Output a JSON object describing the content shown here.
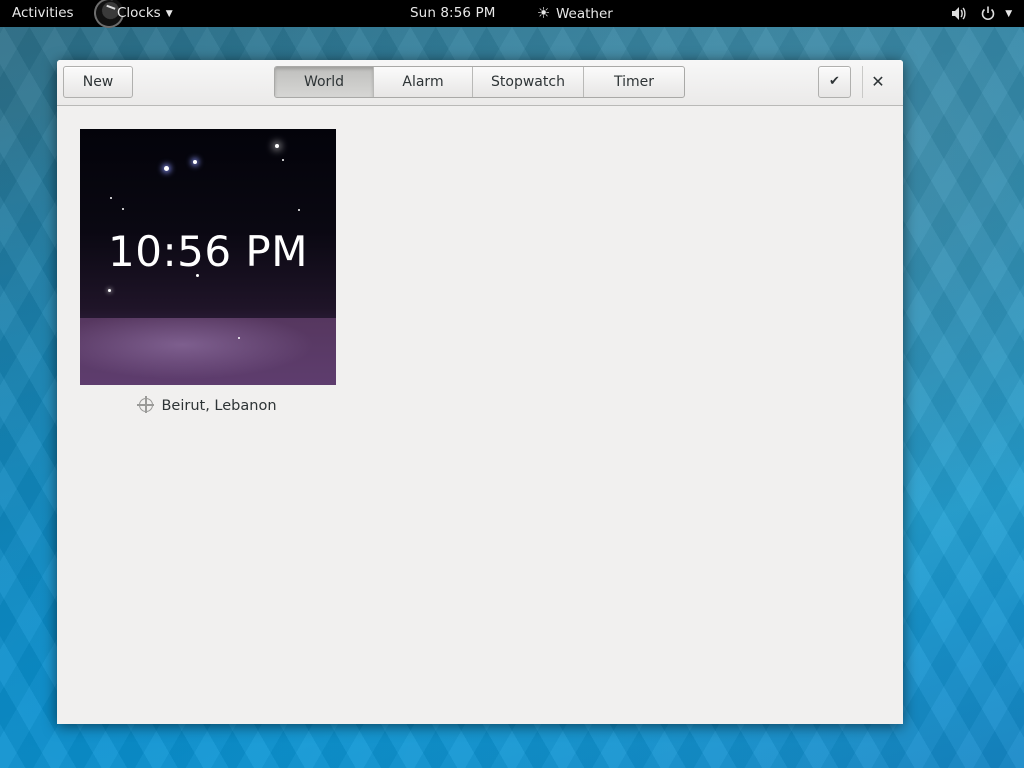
{
  "topbar": {
    "activities": "Activities",
    "app_menu": "Clocks",
    "clock": "Sun  8:56 PM",
    "weather": "Weather",
    "icons": {
      "app": "clocks-app-icon",
      "weather": "sun-icon",
      "volume": "volume-icon",
      "power": "power-icon"
    }
  },
  "headerbar": {
    "new_label": "New",
    "tabs": [
      {
        "label": "World",
        "active": true
      },
      {
        "label": "Alarm",
        "active": false
      },
      {
        "label": "Stopwatch",
        "active": false
      },
      {
        "label": "Timer",
        "active": false
      }
    ],
    "select_icon": "checkmark-icon",
    "close_icon": "close-icon"
  },
  "world": {
    "clocks": [
      {
        "time": "10:56 PM",
        "location": "Beirut, Lebanon",
        "icon": "location-icon"
      }
    ]
  },
  "colors": {
    "window_bg": "#f1f0ef",
    "topbar_bg": "#000000",
    "tile_night_sky": "#03030a",
    "tile_ground": "#5e3d6e"
  }
}
